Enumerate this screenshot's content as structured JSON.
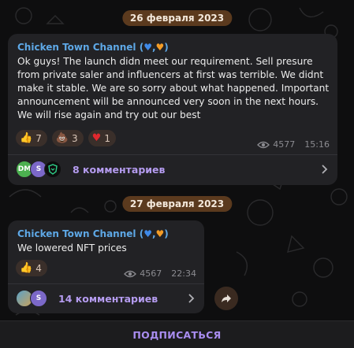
{
  "dates": [
    "26 февраля 2023",
    "27 февраля 2023"
  ],
  "posts": [
    {
      "author": "Chicken Town Channel (",
      "author_end": ")",
      "text": "Ok guys! The launch didn meet our requirement. Sell presure from private saler and influencers at first was terrible. We didnt make it stable. We are so sorry about what happened. Important announcement will be announced very soon in the next hours. We will rise again and try out our best",
      "reactions": [
        {
          "emoji": "👍",
          "count": "7"
        },
        {
          "emoji": "💩",
          "count": "3"
        },
        {
          "emoji": "♥",
          "count": "1"
        }
      ],
      "views": "4577",
      "time": "15:16",
      "avatars": [
        "DM",
        "S",
        ""
      ],
      "comments": "8 комментариев"
    },
    {
      "author": "Chicken Town Channel (",
      "author_end": ")",
      "text": "We lowered NFT prices",
      "reactions": [
        {
          "emoji": "👍",
          "count": "4"
        }
      ],
      "views": "4567",
      "time": "22:34",
      "avatars": [
        "",
        "S"
      ],
      "comments": "14 комментариев"
    }
  ],
  "footer": {
    "subscribe": "ПОДПИСАТЬСЯ"
  },
  "colors": {
    "accent": "#a98df0",
    "link": "#5ea8e6",
    "date_pill": "#5b3a1e",
    "bubble": "#222225"
  }
}
